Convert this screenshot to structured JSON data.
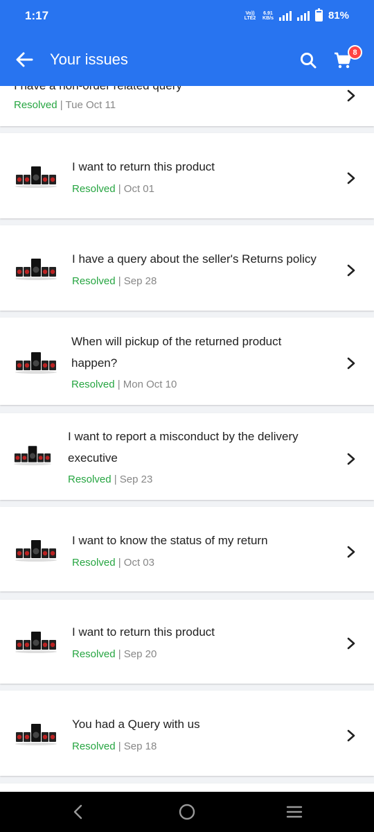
{
  "status_bar": {
    "time": "1:17",
    "network_label": "Vo)) LTE2",
    "speed_value": "6.91",
    "speed_unit": "KB/s",
    "battery": "81%"
  },
  "app_bar": {
    "title": "Your issues",
    "cart_count": "8",
    "icons": [
      "back-arrow-icon",
      "search-icon",
      "cart-icon"
    ]
  },
  "issues": [
    {
      "title": "I have a non-order related query",
      "status": "Resolved",
      "date": "Tue Oct 11",
      "has_image": false
    },
    {
      "title": "I want to return this product",
      "status": "Resolved",
      "date": "Oct 01",
      "has_image": true
    },
    {
      "title": "I have a query about the seller's Returns policy",
      "status": "Resolved",
      "date": "Sep 28",
      "has_image": true
    },
    {
      "title": "When will pickup of the returned product happen?",
      "status": "Resolved",
      "date": "Mon Oct 10",
      "has_image": true
    },
    {
      "title": "I want to report a misconduct by the delivery executive",
      "status": "Resolved",
      "date": "Sep 23",
      "has_image": true
    },
    {
      "title": "I want to know the status of my return",
      "status": "Resolved",
      "date": "Oct 03",
      "has_image": true
    },
    {
      "title": "I want to return this product",
      "status": "Resolved",
      "date": "Sep 20",
      "has_image": true
    },
    {
      "title": "You had a Query with us",
      "status": "Resolved",
      "date": "Sep 18",
      "has_image": true
    }
  ],
  "colors": {
    "brand_blue": "#2874f0",
    "resolved_green": "#26a541",
    "badge_red": "#ff4343"
  },
  "nav_bar": {
    "icons": [
      "back-nav-icon",
      "home-nav-icon",
      "recents-nav-icon"
    ]
  }
}
